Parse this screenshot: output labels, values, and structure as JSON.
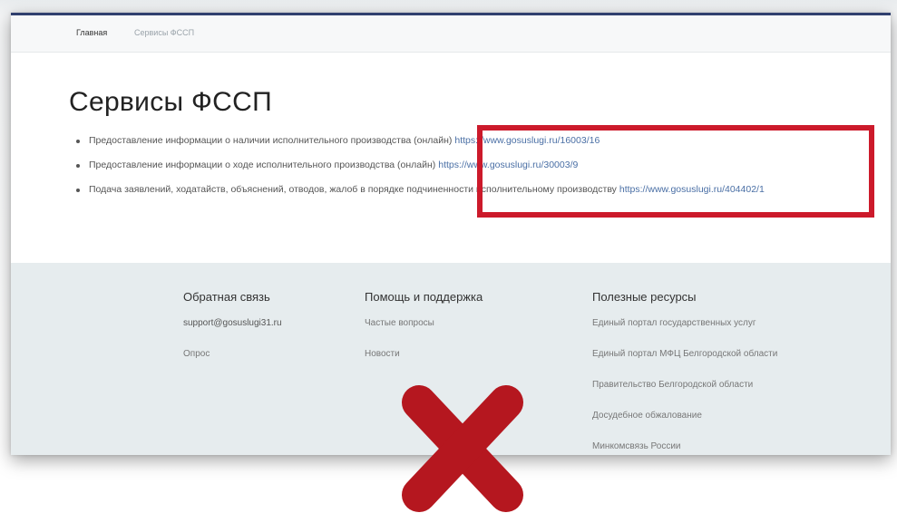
{
  "breadcrumb": {
    "home": "Главная",
    "current": "Сервисы ФССП"
  },
  "page": {
    "title": "Сервисы ФССП"
  },
  "services": [
    {
      "text": "Предоставление информации о наличии исполнительного производства (онлайн)",
      "url": "https://www.gosuslugi.ru/16003/16"
    },
    {
      "text": "Предоставление информации о ходе исполнительного производства (онлайн)",
      "url": "https://www.gosuslugi.ru/30003/9"
    },
    {
      "text": "Подача заявлений, ходатайств, объяснений, отводов, жалоб в порядке подчиненности исполнительному производству",
      "url": "https://www.gosuslugi.ru/404402/1"
    }
  ],
  "footer": {
    "feedback": {
      "heading": "Обратная связь",
      "email": "support@gosuslugi31.ru",
      "survey": "Опрос"
    },
    "help": {
      "heading": "Помощь и поддержка",
      "faq": "Частые вопросы",
      "news": "Новости"
    },
    "resources": {
      "heading": "Полезные ресурсы",
      "items": [
        "Единый портал государственных услуг",
        "Единый портал МФЦ Белгородской области",
        "Правительство Белгородской области",
        "Досудебное обжалование",
        "Минкомсвязь России"
      ]
    }
  },
  "colors": {
    "highlight": "#cc1a2b",
    "link": "#4a6fa5",
    "footer_bg": "#e6ecee",
    "cross": "#b5171f"
  },
  "icons": {
    "cross": "cross-mark-icon"
  }
}
